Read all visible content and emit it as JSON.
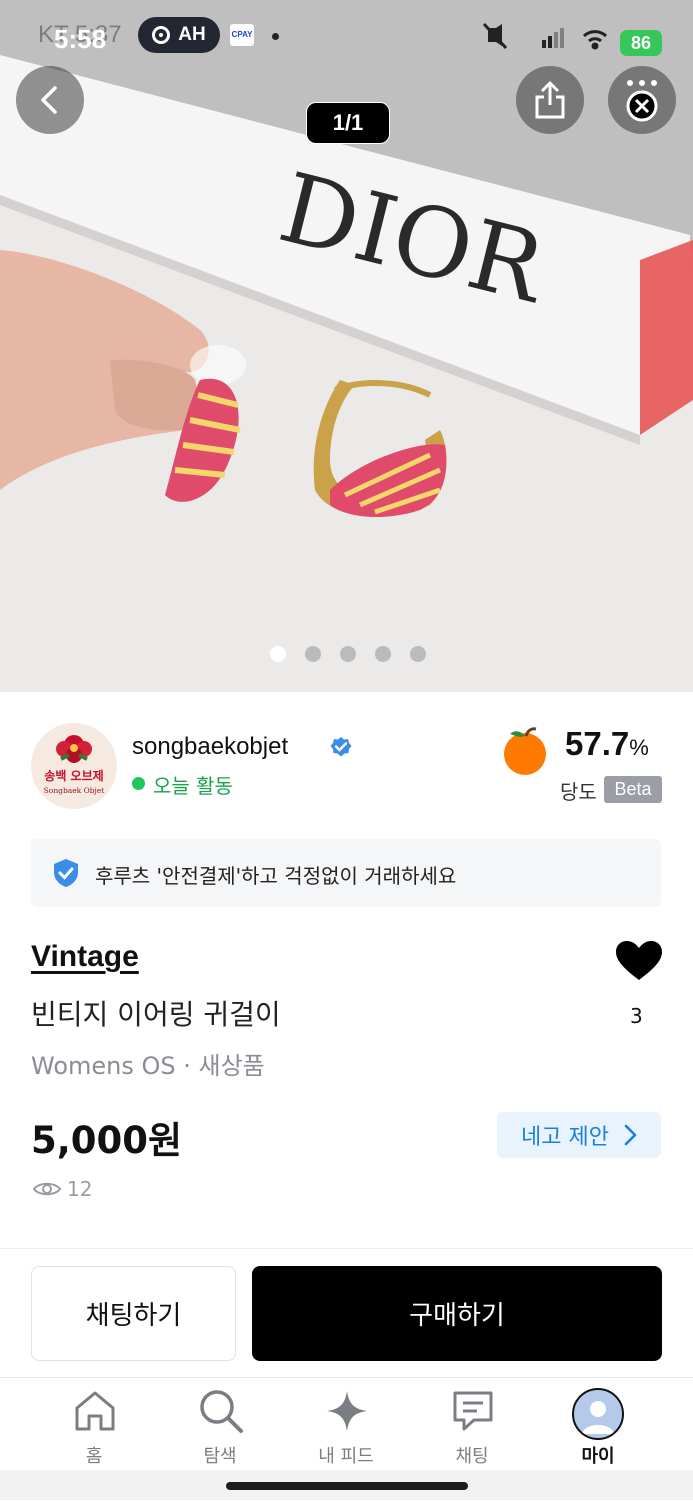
{
  "status_bar": {
    "time": "5:58",
    "time_ghost": "KT 5:37",
    "pill_label": "AH",
    "battery": "86"
  },
  "hero": {
    "counter": "1/1",
    "photo_text": "DIOR",
    "dots_total": 5,
    "dots_active_index": 0
  },
  "seller": {
    "name": "songbaekobjet",
    "activity": "오늘 활동",
    "logo_text_ko": "송백 오브제",
    "logo_text_en": "Songbaek Objet",
    "score": "57.7",
    "score_unit": "%",
    "score_label": "당도",
    "beta_label": "Beta"
  },
  "safe_payment": {
    "text": "후루츠 '안전결제'하고 걱정없이 거래하세요"
  },
  "product": {
    "brand": "Vintage",
    "title": "빈티지 이어링 귀걸이",
    "meta": "Womens OS · 새상품",
    "price": "5,000원",
    "offer_label": "네고 제안",
    "views": "12",
    "likes": "3"
  },
  "actions": {
    "chat_label": "채팅하기",
    "buy_label": "구매하기"
  },
  "tabbar": {
    "items": [
      {
        "label": "홈"
      },
      {
        "label": "탐색"
      },
      {
        "label": "내 피드"
      },
      {
        "label": "채팅"
      },
      {
        "label": "마이"
      }
    ]
  },
  "colors": {
    "accent_blue": "#1c7fe0",
    "active_green": "#22c55e",
    "battery_green": "#35c759",
    "beta_gray": "#9b9ea6"
  }
}
